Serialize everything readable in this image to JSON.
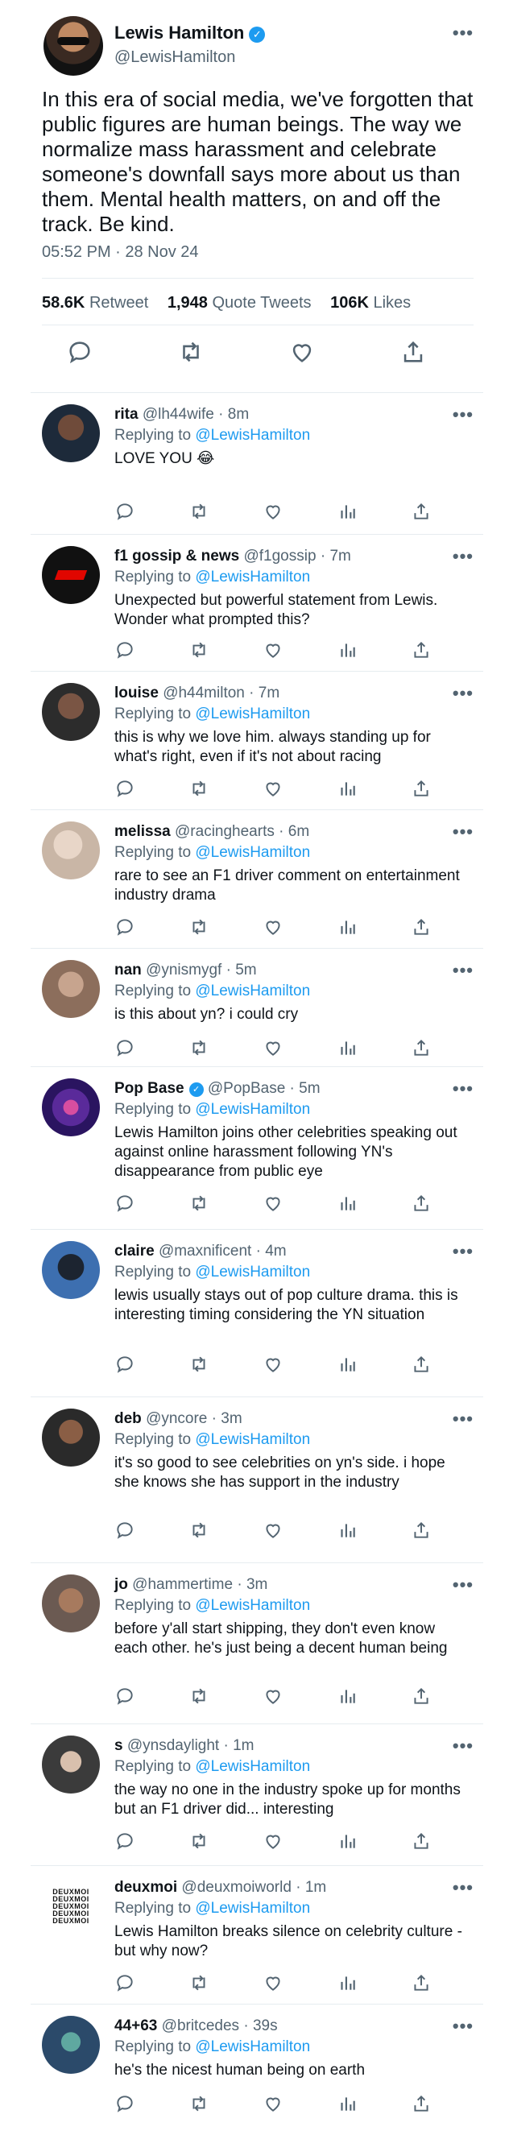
{
  "main": {
    "name": "Lewis Hamilton",
    "handle": "@LewisHamilton",
    "text": "In this era of social media, we've forgotten that public figures are human beings. The way we normalize mass harassment and celebrate someone's downfall says more about us than them. Mental health matters, on and off the track. Be kind.",
    "timestamp": "05:52 PM · 28 Nov 24",
    "retweets": "58.6K",
    "retweets_label": "Retweet",
    "quotes": "1,948",
    "quotes_label": "Quote Tweets",
    "likes": "106K",
    "likes_label": "Likes",
    "more": "•••",
    "verified_icon": "✓"
  },
  "replying_label": "Replying to",
  "replying_mention": "@LewisHamilton",
  "replies": [
    {
      "name": "rita",
      "handle": "@lh44wife",
      "time": "8m",
      "text": "LOVE YOU 😂",
      "avatar_color": "#1d2a3a"
    },
    {
      "name": "f1 gossip & news",
      "handle": "@f1gossip",
      "time": "7m",
      "text": "Unexpected but powerful statement from Lewis. Wonder what prompted this?",
      "avatar_color": "#111111"
    },
    {
      "name": "louise",
      "handle": "@h44milton",
      "time": "7m",
      "text": "this is why we love him. always standing up for what's right, even if it's not about racing",
      "avatar_color": "#2c2c2c"
    },
    {
      "name": "melissa",
      "handle": "@racinghearts",
      "time": "6m",
      "text": "rare to see an F1 driver comment on entertainment industry drama",
      "avatar_color": "#c9b6a6"
    },
    {
      "name": "nan",
      "handle": "@ynismygf",
      "time": "5m",
      "text": "is this about yn? i could cry",
      "avatar_color": "#8c6e5c"
    },
    {
      "name": "Pop Base",
      "handle": "@PopBase",
      "time": "5m",
      "text": "Lewis Hamilton joins other celebrities speaking out against online harassment following YN's disappearance from public eye",
      "avatar_color": "#3a1f7a"
    },
    {
      "name": "claire",
      "handle": "@maxnificent",
      "time": "4m",
      "text": "lewis usually stays out of pop culture drama. this is interesting timing considering the YN situation",
      "avatar_color": "#3d6fb0"
    },
    {
      "name": "deb",
      "handle": "@yncore",
      "time": "3m",
      "text": "it's so good to see celebrities on yn's side. i hope she knows she has support in the industry",
      "avatar_color": "#2a2a2a"
    },
    {
      "name": "jo",
      "handle": "@hammertime",
      "time": "3m",
      "text": "before y'all start shipping, they don't even know each other. he's just being a decent human being",
      "avatar_color": "#6b5a52"
    },
    {
      "name": "s",
      "handle": "@ynsdaylight",
      "time": "1m",
      "text": "the way no one in the industry spoke up for months but an F1 driver did... interesting",
      "avatar_color": "#3b3b3b"
    },
    {
      "name": "deuxmoi",
      "handle": "@deuxmoiworld",
      "time": "1m",
      "text": "Lewis Hamilton breaks silence on celebrity culture - but why now?",
      "avatar_color": "#ffffff",
      "logo_text": "DEUXMOI DEUXMOI DEUXMOI DEUXMOI DEUXMOI"
    },
    {
      "name": "44+63",
      "handle": "@britcedes",
      "time": "39s",
      "text": "he's the nicest human being on earth",
      "avatar_color": "#2b4a6a"
    }
  ],
  "colors": {
    "accent": "#1d9bf0",
    "secondary": "#536471",
    "divider": "#e6ecf0"
  }
}
